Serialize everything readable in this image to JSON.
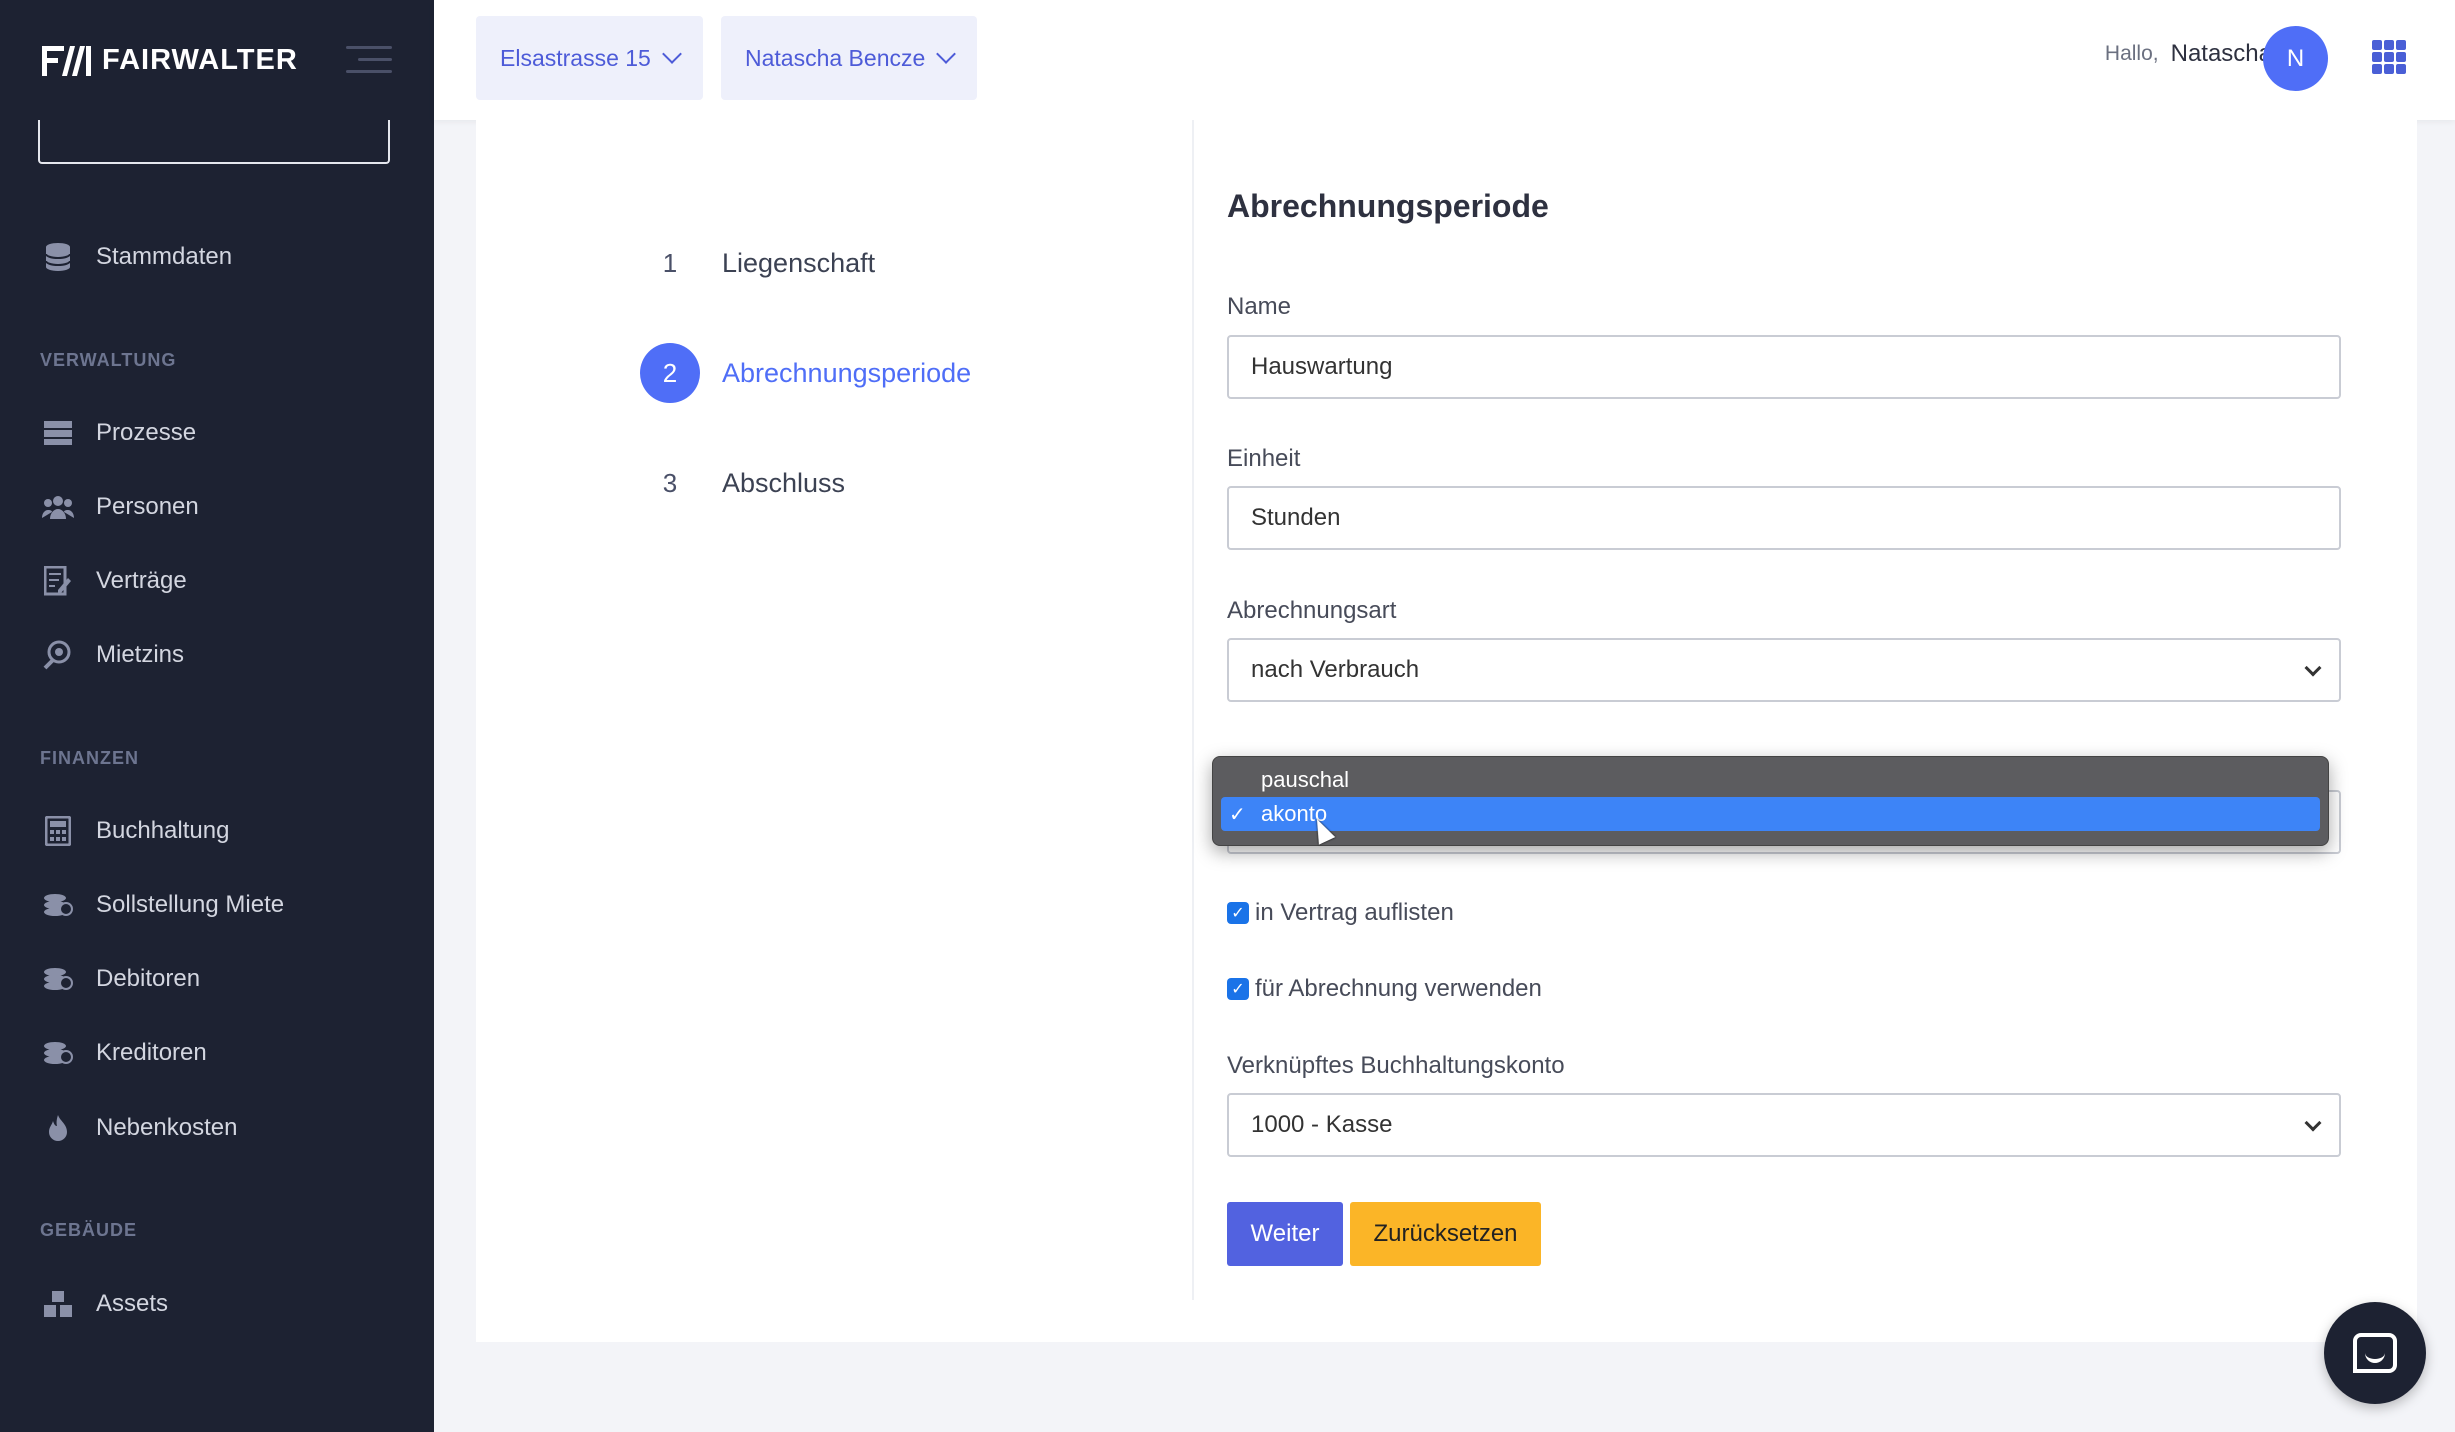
{
  "brand": {
    "name": "FAIRWALTER"
  },
  "sidebar": {
    "items_top": [
      {
        "label": "Stammdaten",
        "icon": "database-icon"
      }
    ],
    "sections": [
      {
        "title": "VERWALTUNG",
        "items": [
          {
            "label": "Prozesse",
            "icon": "process-icon"
          },
          {
            "label": "Personen",
            "icon": "people-icon"
          },
          {
            "label": "Verträge",
            "icon": "contract-icon"
          },
          {
            "label": "Mietzins",
            "icon": "rent-icon"
          }
        ]
      },
      {
        "title": "FINANZEN",
        "items": [
          {
            "label": "Buchhaltung",
            "icon": "calculator-icon"
          },
          {
            "label": "Sollstellung Miete",
            "icon": "coins-icon"
          },
          {
            "label": "Debitoren",
            "icon": "coins-icon"
          },
          {
            "label": "Kreditoren",
            "icon": "coins-icon"
          },
          {
            "label": "Nebenkosten",
            "icon": "flame-icon"
          }
        ]
      },
      {
        "title": "GEBÄUDE",
        "items": [
          {
            "label": "Assets",
            "icon": "boxes-icon"
          }
        ]
      }
    ]
  },
  "topbar": {
    "property": "Elsastrasse 15",
    "person": "Natascha Bencze",
    "greeting": "Hallo,",
    "user_name": "Natascha",
    "avatar_initial": "N"
  },
  "steps": [
    {
      "number": "1",
      "label": "Liegenschaft"
    },
    {
      "number": "2",
      "label": "Abrechnungsperiode"
    },
    {
      "number": "3",
      "label": "Abschluss"
    }
  ],
  "form": {
    "title": "Abrechnungsperiode",
    "name_label": "Name",
    "name_value": "Hauswartung",
    "unit_label": "Einheit",
    "unit_value": "Stunden",
    "billing_type_label": "Abrechnungsart",
    "billing_type_value": "nach Verbrauch",
    "dropdown_options": [
      "pauschal",
      "akonto"
    ],
    "dropdown_selected": "akonto",
    "check_contract": "in Vertrag auflisten",
    "check_billing": "für Abrechnung verwenden",
    "account_label": "Verknüpftes Buchhaltungskonto",
    "account_value": "1000 - Kasse",
    "next_button": "Weiter",
    "reset_button": "Zurücksetzen"
  },
  "colors": {
    "accent": "#4f6ef7",
    "sidebar_bg": "#1d2232",
    "warning": "#fbb527"
  }
}
